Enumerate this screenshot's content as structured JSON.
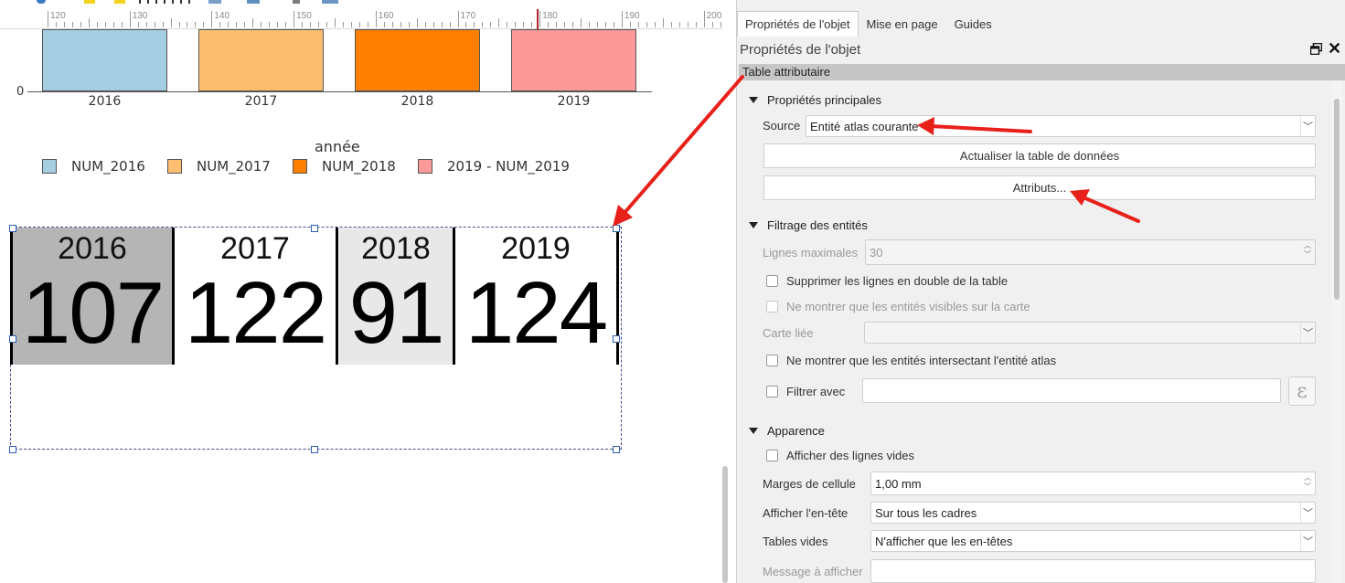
{
  "ruler": {
    "labels": [
      "120",
      "130",
      "140",
      "150",
      "160",
      "170",
      "180",
      "190",
      "200"
    ]
  },
  "chart_data": {
    "type": "bar",
    "categories": [
      "2016",
      "2017",
      "2018",
      "2019"
    ],
    "series": [
      {
        "name": "NUM_2016",
        "color": "#a6cee3"
      },
      {
        "name": "NUM_2017",
        "color": "#fdbf6f"
      },
      {
        "name": "NUM_2018",
        "color": "#ff7f00"
      },
      {
        "name": "2019 - NUM_2019",
        "color": "#fb9a99"
      }
    ],
    "y_tick_visible": "0",
    "legend_title": "année"
  },
  "attr_table": {
    "headers": [
      "2016",
      "2017",
      "2018",
      "2019"
    ],
    "values": [
      "107",
      "122",
      "91",
      "124"
    ],
    "cell_backgrounds": [
      "#b5b5b5",
      "#ffffff",
      "#e8e8e8",
      "#ffffff"
    ]
  },
  "panel": {
    "tabs": [
      "Propriétés de l'objet",
      "Mise en page",
      "Guides"
    ],
    "title": "Propriétés de l'objet",
    "close_glyph": "✕",
    "object_type": "Table attributaire",
    "main_props": {
      "section": "Propriétés principales",
      "source_label": "Source",
      "source_value": "Entité atlas courante",
      "refresh_button": "Actualiser la table de données",
      "attributes_button": "Attributs..."
    },
    "filtering": {
      "section": "Filtrage des entités",
      "max_rows_label": "Lignes maximales",
      "max_rows_value": "30",
      "remove_duplicates": "Supprimer les lignes en double de la table",
      "visible_only": "Ne montrer que les entités visibles sur la carte",
      "linked_map_label": "Carte liée",
      "intersecting_only": "Ne montrer que les entités intersectant l'entité atlas",
      "filter_with": "Filtrer avec",
      "expression_glyph": "ε"
    },
    "appearance": {
      "section": "Apparence",
      "show_empty_rows": "Afficher des lignes vides",
      "cell_margins_label": "Marges de cellule",
      "cell_margins_value": "1,00 mm",
      "show_header_label": "Afficher l'en-tête",
      "show_header_value": "Sur tous les cadres",
      "empty_tables_label": "Tables vides",
      "empty_tables_value": "N'afficher que les en-têtes",
      "message_label": "Message à afficher"
    }
  },
  "colors": {
    "annotation_arrow": "#e8201a",
    "ruler_cursor": "#b3282d",
    "selection_handle": "#2f5db2"
  }
}
